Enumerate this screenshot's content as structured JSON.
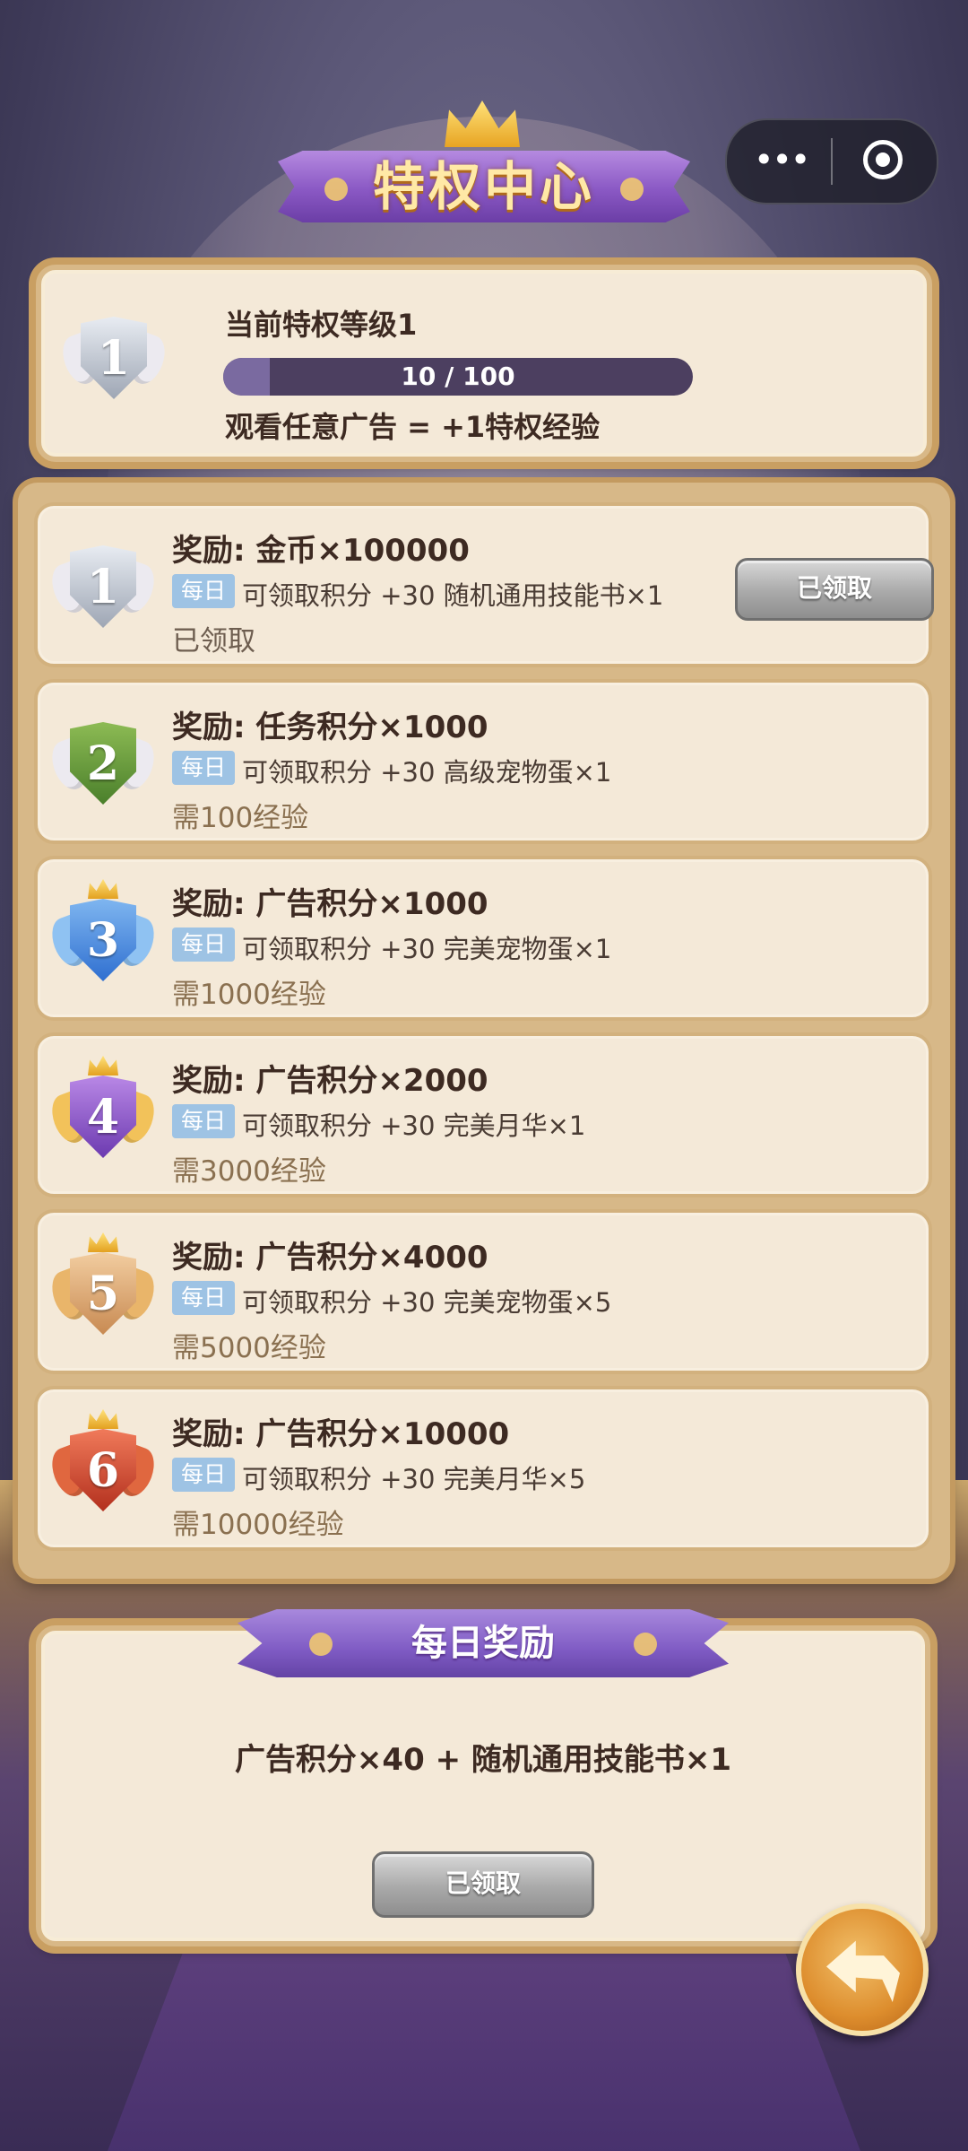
{
  "header": {
    "title": "特权中心"
  },
  "capsule": {
    "more_icon": "more-dots-icon",
    "close_icon": "target-close-icon"
  },
  "level": {
    "title": "当前特权等级1",
    "badge_number": "1",
    "progress_text": "10 / 100",
    "progress_fraction": 0.1,
    "hint": "观看任意广告 = +1特权经验"
  },
  "daily_tag": "每日",
  "rewards": [
    {
      "badge": "1",
      "title": "奖励: 金币×100000",
      "detail": "可领取积分 +30  随机通用技能书×1",
      "status": "已领取",
      "button": "已领取"
    },
    {
      "badge": "2",
      "title": "奖励: 任务积分×1000",
      "detail": "可领取积分 +30  高级宠物蛋×1",
      "status": "需100经验"
    },
    {
      "badge": "3",
      "title": "奖励: 广告积分×1000",
      "detail": "可领取积分 +30  完美宠物蛋×1",
      "status": "需1000经验"
    },
    {
      "badge": "4",
      "title": "奖励: 广告积分×2000",
      "detail": "可领取积分 +30  完美月华×1",
      "status": "需3000经验"
    },
    {
      "badge": "5",
      "title": "奖励: 广告积分×4000",
      "detail": "可领取积分 +30  完美宠物蛋×5",
      "status": "需5000经验"
    },
    {
      "badge": "6",
      "title": "奖励: 广告积分×10000",
      "detail": "可领取积分 +30  完美月华×5",
      "status": "需10000经验"
    }
  ],
  "daily": {
    "title": "每日奖励",
    "reward": "广告积分×40 + 随机通用技能书×1",
    "button": "已领取"
  },
  "colors": {
    "accent_purple": "#8a58c4",
    "panel_bg": "#f4e9d8",
    "tag_blue": "#9ec3e4"
  }
}
